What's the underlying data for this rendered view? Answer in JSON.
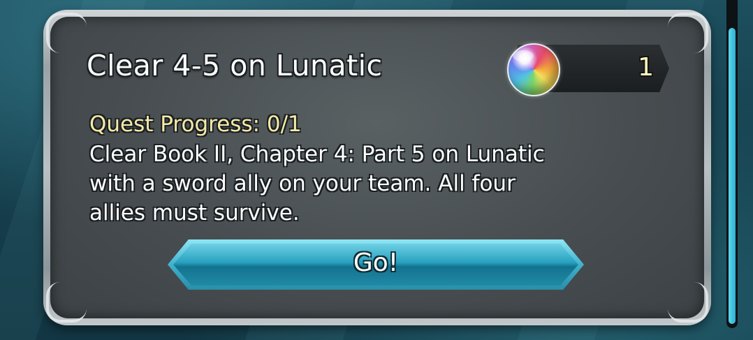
{
  "quest": {
    "title": "Clear 4-5 on Lunatic",
    "progress": "Quest Progress: 0/1",
    "description": "Clear Book II, Chapter 4: Part 5 on Lunatic\nwith a sword ally on your team. All four\nallies must survive."
  },
  "reward": {
    "icon": "orb-icon",
    "count": "1"
  },
  "actions": {
    "go_label": "Go!"
  },
  "scrollbar": {
    "position_fraction": 0.0
  },
  "colors": {
    "title": "#ffffff",
    "progress": "#f6eaa6",
    "reward_count": "#fff7b8",
    "go_button": "#27a1bf",
    "scrollbar": "#2fb1cf"
  }
}
